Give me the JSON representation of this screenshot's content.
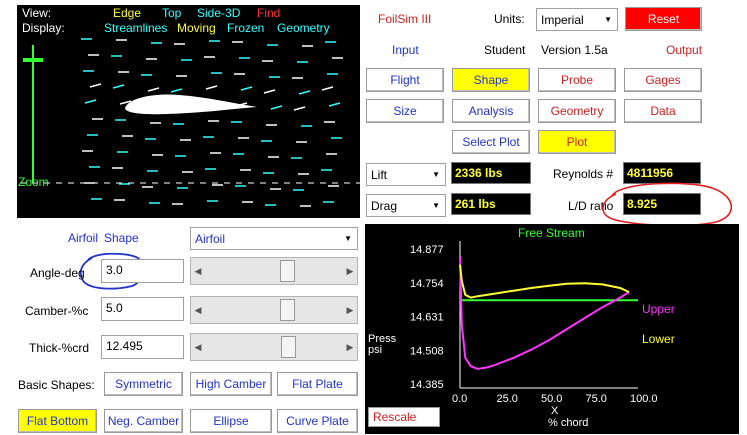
{
  "view_panel": {
    "view_label": "View:",
    "view_items": [
      "Edge",
      "Top",
      "Side-3D",
      "Find"
    ],
    "display_label": "Display:",
    "display_items": [
      "Streamlines",
      "Moving",
      "Frozen",
      "Geometry"
    ],
    "zoom_label": "Zoom"
  },
  "header": {
    "app_title": "FoilSim III",
    "units_label": "Units:",
    "units_value": "Imperial",
    "reset_label": "Reset",
    "input_label": "Input",
    "student_label": "Student",
    "version_label": "Version 1.5a",
    "output_label": "Output"
  },
  "buttons": {
    "flight": "Flight",
    "shape": "Shape",
    "probe": "Probe",
    "gages": "Gages",
    "size": "Size",
    "analysis": "Analysis",
    "geometry": "Geometry",
    "data": "Data",
    "select_plot": "Select Plot",
    "plot": "Plot"
  },
  "results": {
    "lift_select": "Lift",
    "lift_value": "2336 lbs",
    "drag_select": "Drag",
    "drag_value": "261 lbs",
    "reynolds_label": "Reynolds #",
    "reynolds_value": "4811956",
    "ld_label": "L/D ratio",
    "ld_value": "8.925"
  },
  "shape_panel": {
    "airfoil_label": "Airfoil",
    "shape_label": "Shape",
    "shape_select": "Airfoil",
    "angle_label": "Angle-deg",
    "angle_value": "3.0",
    "angle_slider": 0.6,
    "camber_label": "Camber-%c",
    "camber_value": "5.0",
    "camber_slider": 0.6,
    "thick_label": "Thick-%crd",
    "thick_value": "12.495",
    "thick_slider": 0.61,
    "basic_shapes_label": "Basic Shapes:",
    "symmetric": "Symmetric",
    "high_camber": "High Camber",
    "flat_plate": "Flat Plate",
    "flat_bottom": "Flat Bottom",
    "neg_camber": "Neg. Camber",
    "ellipse": "Ellipse",
    "curve_plate": "Curve Plate"
  },
  "plot_panel": {
    "free_stream_label": "Free Stream",
    "upper_label": "Upper",
    "lower_label": "Lower",
    "rescale_label": "Rescale"
  },
  "chart_data": {
    "type": "line",
    "xlabel": "X % chord",
    "ylabel": "Press psi",
    "xticks": [
      "0.0",
      "25.0",
      "50.0",
      "75.0",
      "100.0"
    ],
    "yticks": [
      "14.877",
      "14.754",
      "14.631",
      "14.508",
      "14.385"
    ],
    "xlim": [
      0,
      100
    ],
    "ylim": [
      14.385,
      14.877
    ],
    "series": [
      {
        "name": "Free Stream",
        "color": "#33ff33",
        "x": [
          0,
          100
        ],
        "y": [
          14.69,
          14.69
        ]
      },
      {
        "name": "Upper",
        "color": "#ff33ff",
        "x": [
          0,
          1,
          3,
          6,
          10,
          15,
          20,
          30,
          40,
          50,
          60,
          70,
          80,
          90,
          95
        ],
        "y": [
          14.85,
          14.6,
          14.48,
          14.45,
          14.44,
          14.445,
          14.455,
          14.48,
          14.51,
          14.545,
          14.585,
          14.625,
          14.665,
          14.7,
          14.72
        ]
      },
      {
        "name": "Lower",
        "color": "#ffff33",
        "x": [
          0,
          1,
          3,
          6,
          10,
          20,
          30,
          40,
          50,
          60,
          70,
          80,
          90,
          95
        ],
        "y": [
          14.82,
          14.76,
          14.71,
          14.7,
          14.705,
          14.715,
          14.725,
          14.735,
          14.743,
          14.75,
          14.752,
          14.748,
          14.735,
          14.72
        ]
      }
    ]
  }
}
